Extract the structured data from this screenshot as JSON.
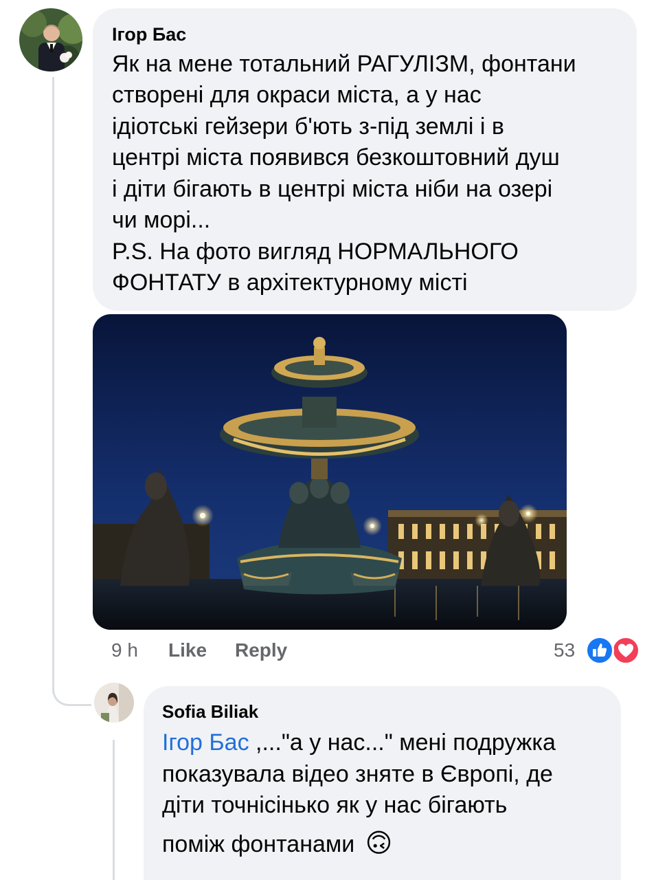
{
  "comment": {
    "author": "Ігор Бас",
    "lines": [
      "Як на мене тотальний РАГУЛІЗМ, фонтани",
      "створені для окраси міста, а у нас",
      "ідіотські гейзери б'ють з-під землі і в",
      "центрі міста появився безкоштовний душ",
      "і діти бігають в центрі міста ніби на озері",
      "чи морі...",
      "P.S. На фото вигляд НОРМАЛЬНОГО",
      "ФОНТАТУ в архітектурному місті"
    ],
    "time": "9 h",
    "like_label": "Like",
    "reply_label": "Reply",
    "reactions_count": "53",
    "reaction_icons": [
      "like-icon",
      "love-icon"
    ],
    "colors": {
      "like": "#1877f2",
      "love": "#f33e58"
    }
  },
  "reply": {
    "author": "Sofia Biliak",
    "mention": "Ігор Бас",
    "line1_rest": " ,...\"а у нас...\" мені подружка",
    "line2": "показувала відео зняте в Європі, де",
    "line3": "діти точнісінько як у нас бігають",
    "line4": "поміж фонтанами",
    "emoji": "🙃"
  }
}
